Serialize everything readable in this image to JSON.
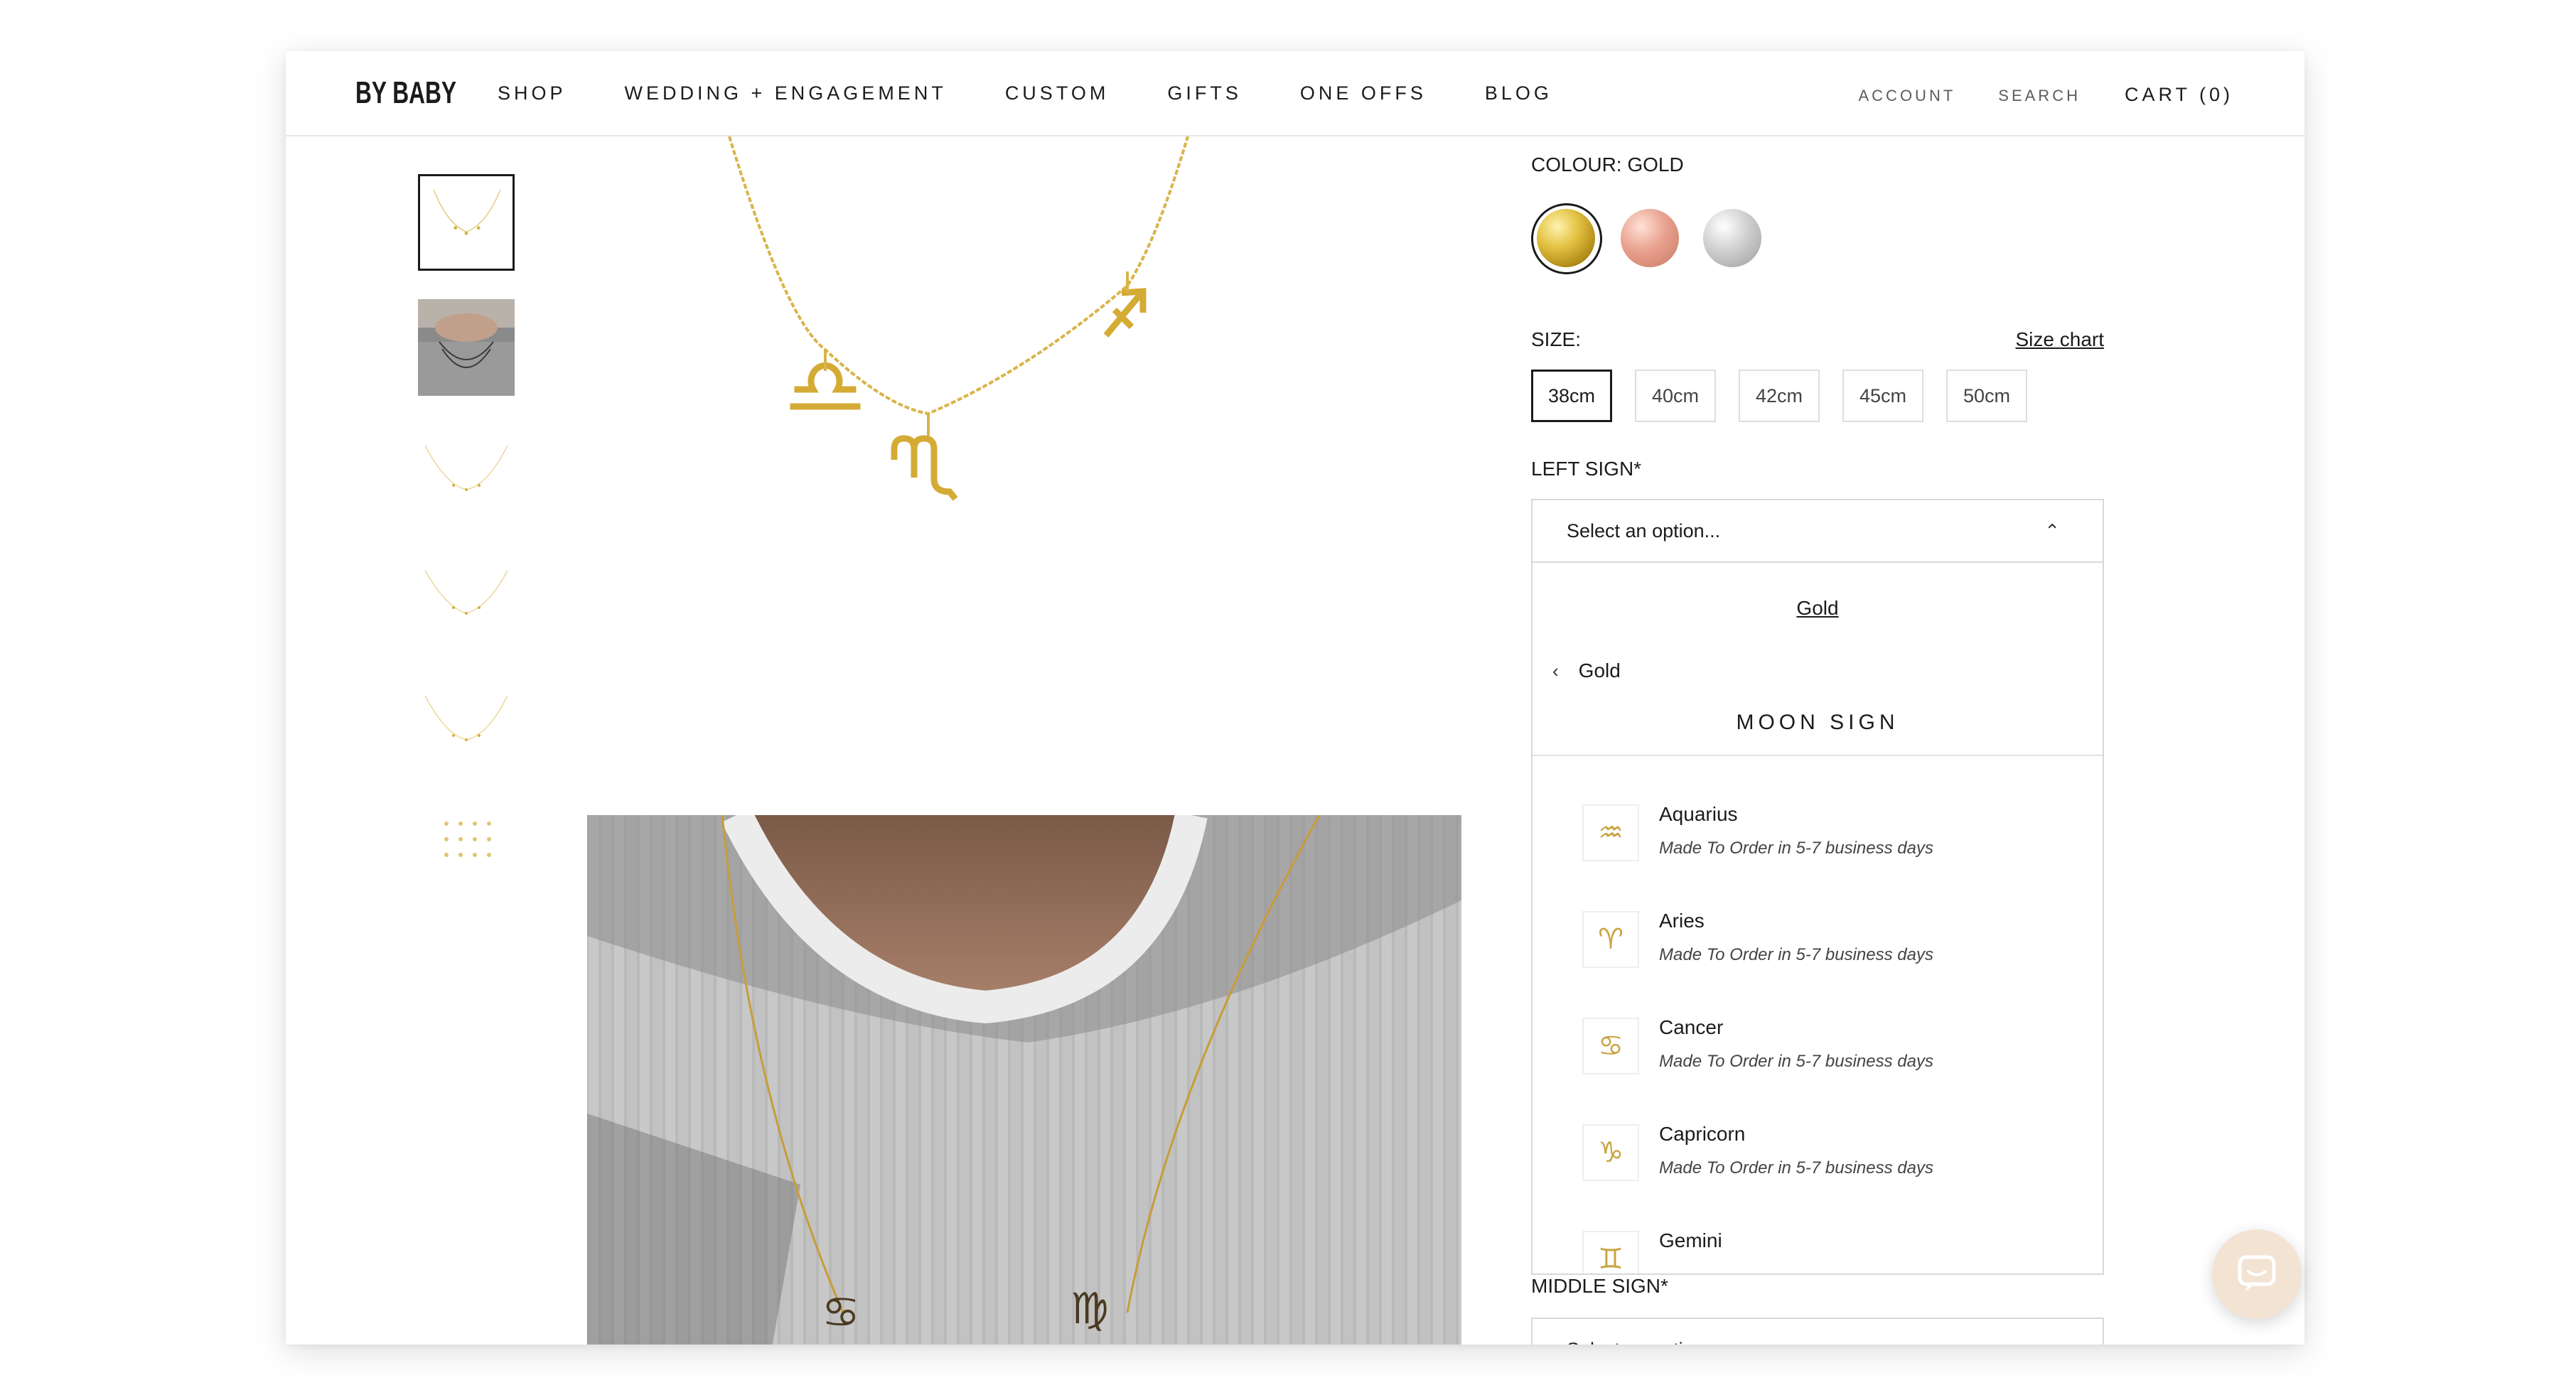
{
  "header": {
    "logo": "BY BABY",
    "nav": [
      "SHOP",
      "WEDDING + ENGAGEMENT",
      "CUSTOM",
      "GIFTS",
      "ONE OFFS",
      "BLOG"
    ],
    "account": "ACCOUNT",
    "search": "SEARCH",
    "cart": "CART (0)"
  },
  "product": {
    "colour_label": "COLOUR: GOLD",
    "swatches": [
      {
        "name": "gold",
        "color": "#d4b13a",
        "selected": true
      },
      {
        "name": "rose-gold",
        "color": "#e29a8a",
        "selected": false
      },
      {
        "name": "silver",
        "color": "#c6c6c6",
        "selected": false
      }
    ],
    "size_label": "SIZE:",
    "size_chart": "Size chart",
    "sizes": [
      "38cm",
      "40cm",
      "42cm",
      "45cm",
      "50cm"
    ],
    "selected_size": "38cm",
    "left_sign_label": "LEFT SIGN*",
    "left_sign_placeholder": "Select an option...",
    "dropdown": {
      "breadcrumb": "Gold",
      "back_label": "Gold",
      "title": "MOON SIGN",
      "options": [
        {
          "name": "Aquarius",
          "note": "Made To Order in 5-7 business days",
          "icon": "aquarius-icon",
          "glyph": "♒"
        },
        {
          "name": "Aries",
          "note": "Made To Order in 5-7 business days",
          "icon": "aries-icon",
          "glyph": "♈"
        },
        {
          "name": "Cancer",
          "note": "Made To Order in 5-7 business days",
          "icon": "cancer-icon",
          "glyph": "♋"
        },
        {
          "name": "Capricorn",
          "note": "Made To Order in 5-7 business days",
          "icon": "capricorn-icon",
          "glyph": "♑"
        },
        {
          "name": "Gemini",
          "note": "",
          "icon": "gemini-icon",
          "glyph": "♊"
        }
      ]
    },
    "middle_sign_label": "MIDDLE SIGN*",
    "middle_sign_placeholder": "Select an option..."
  },
  "colors": {
    "text": "#1c1b1b",
    "border": "#d8d8d8",
    "gold": "#d4b13a",
    "chat_bg": "#f3e3d3"
  }
}
